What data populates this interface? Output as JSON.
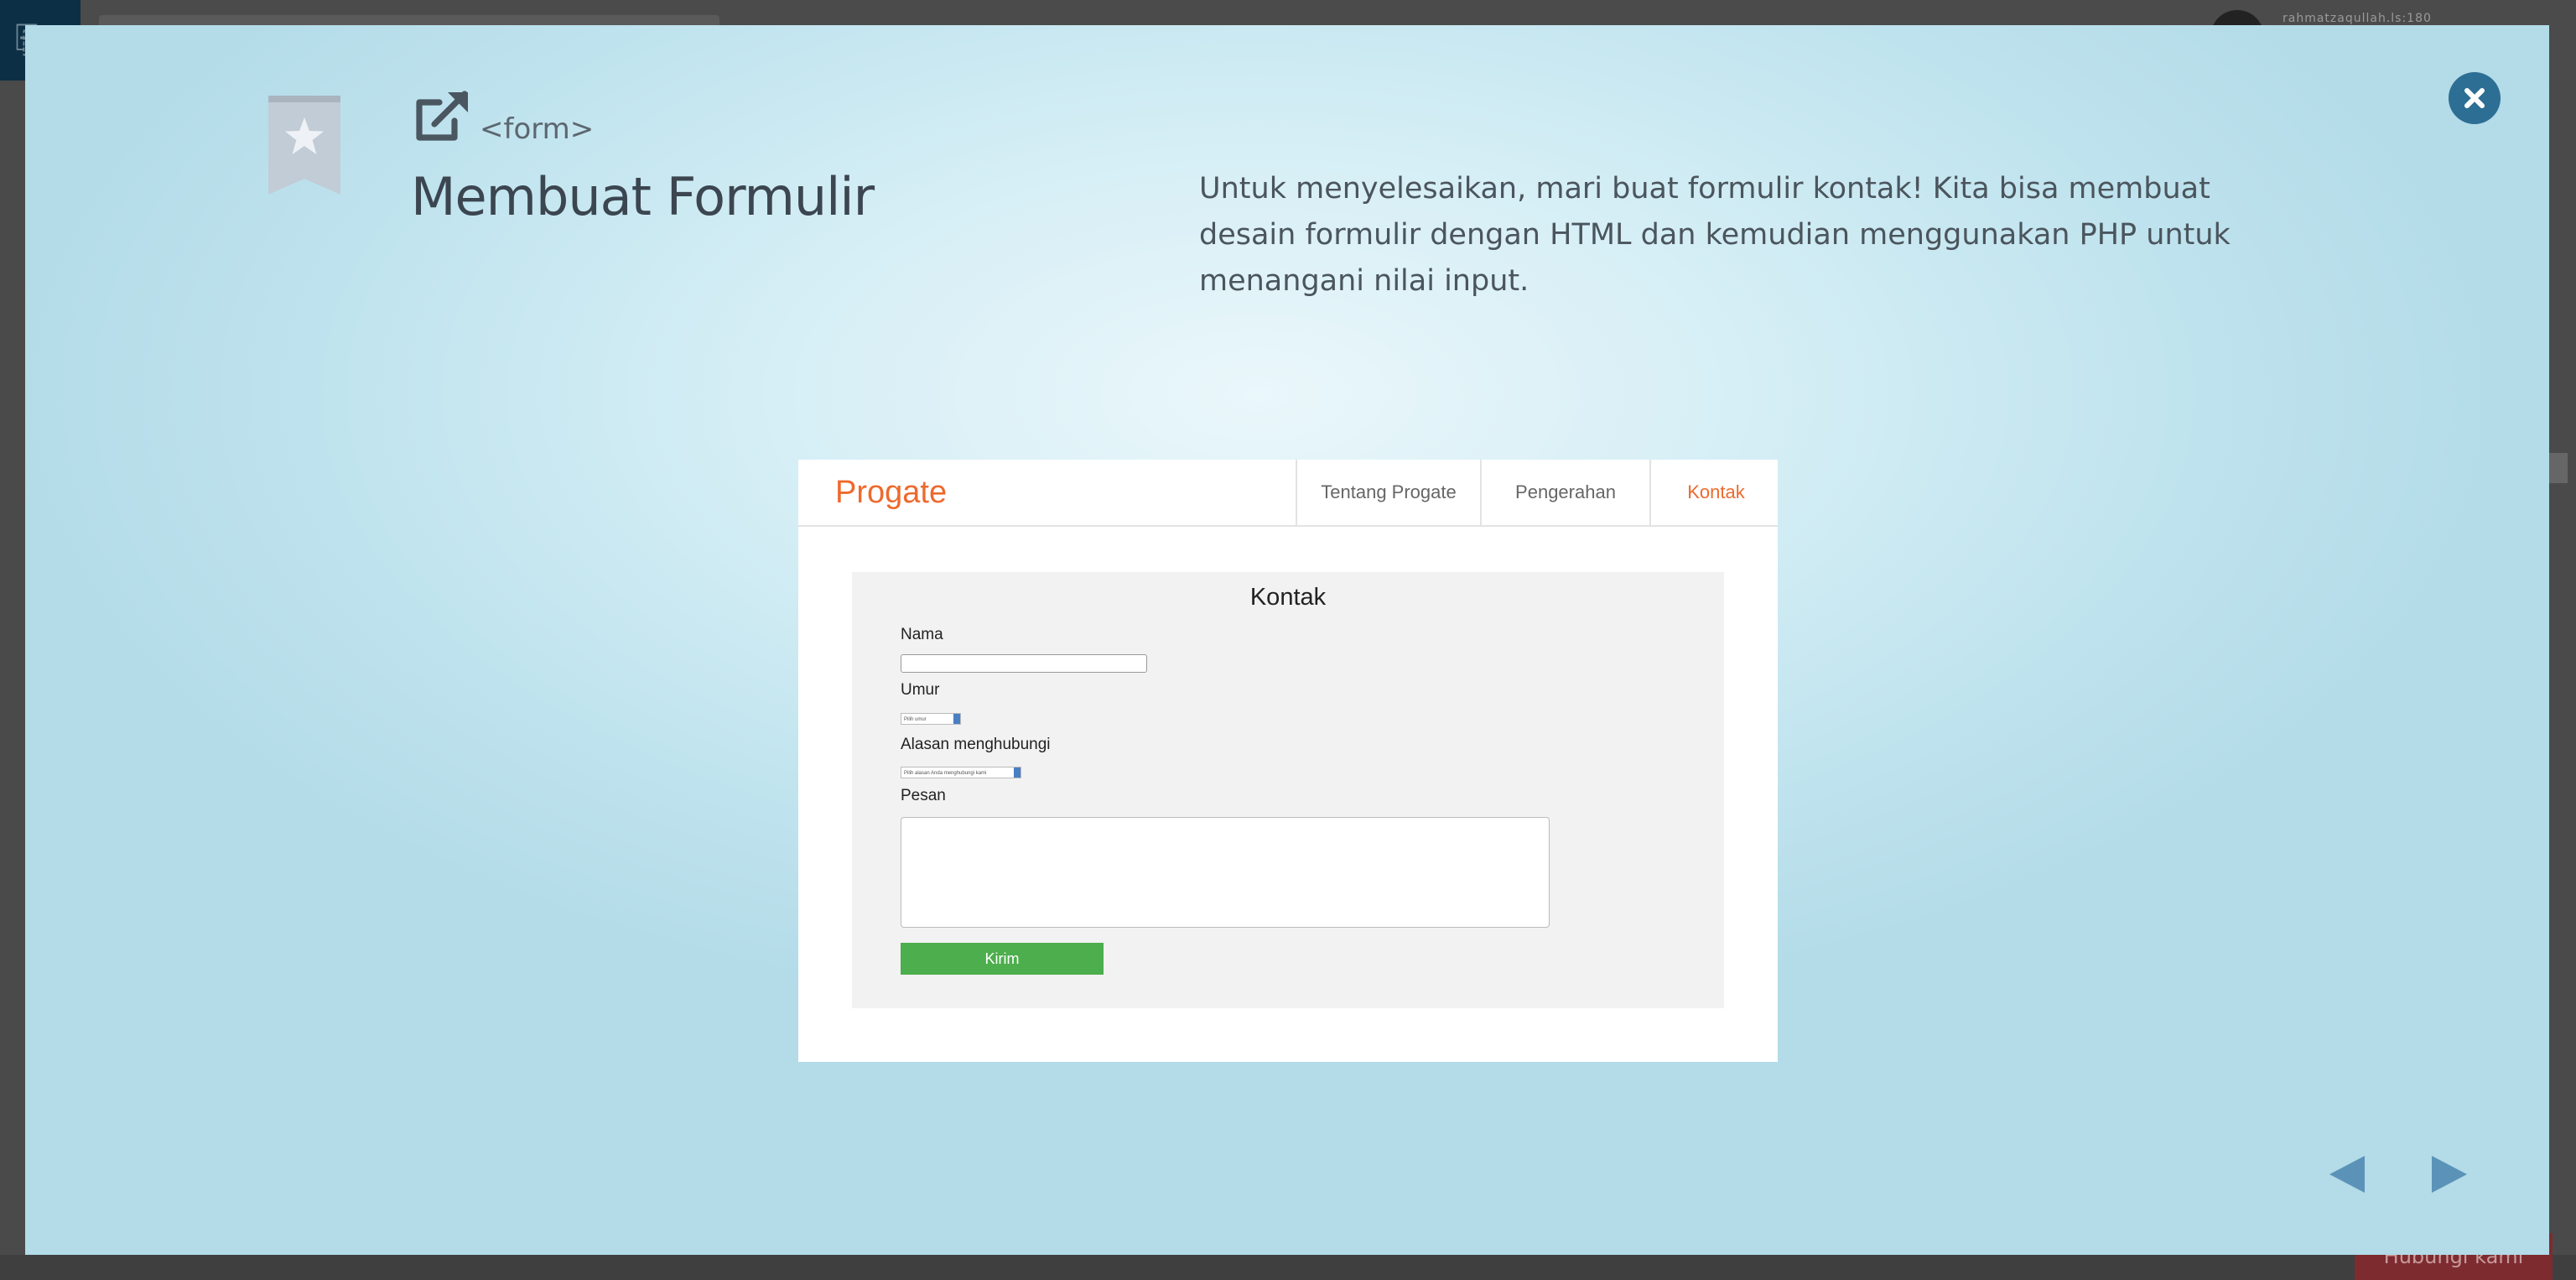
{
  "background": {
    "user_label": "rahmatzaqullah.ls:180",
    "footer_button": "Hubungi kami"
  },
  "slide": {
    "tag": "<form>",
    "title": "Membuat Formulir",
    "description": "Untuk menyelesaikan, mari buat formulir kontak! Kita bisa membuat desain formulir dengan HTML dan kemudian menggunakan PHP untuk menangani nilai input.",
    "icons": {
      "bookmark": "bookmark-star-icon",
      "external": "external-link-icon",
      "close": "close-icon",
      "prev": "triangle-left-icon",
      "next": "triangle-right-icon"
    },
    "colors": {
      "accent": "#2d6e94",
      "nav_arrows": "#5b93b8"
    }
  },
  "illustration": {
    "brand": "Progate",
    "nav": [
      "Tentang Progate",
      "Pengerahan",
      "Kontak"
    ],
    "active_nav": "Kontak",
    "form": {
      "title": "Kontak",
      "name_label": "Nama",
      "age_label": "Umur",
      "age_placeholder": "Pilih umur",
      "reason_label": "Alasan menghubungi",
      "reason_placeholder": "Pilih alasan Anda menghubungi kami",
      "message_label": "Pesan",
      "submit": "Kirim"
    },
    "colors": {
      "brand": "#ed6a2d",
      "submit": "#4cae4c"
    }
  }
}
